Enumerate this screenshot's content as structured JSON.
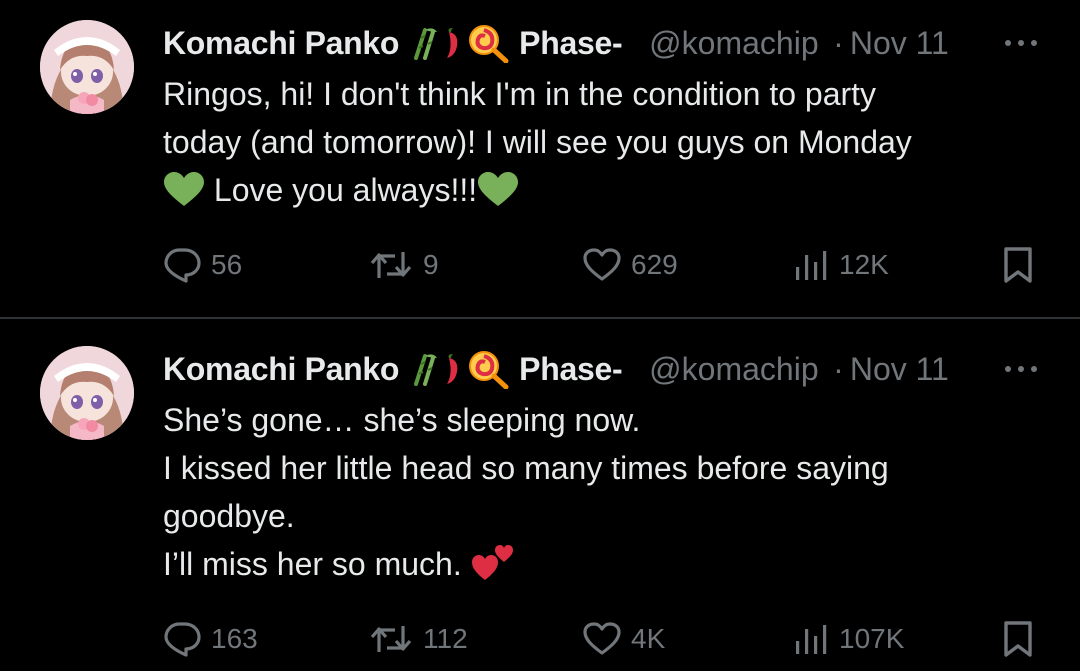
{
  "tweets": [
    {
      "author": "Komachi Panko",
      "display_suffix": "Phase-",
      "handle": "@komachip",
      "separator": "·",
      "date": "Nov 11",
      "emoji_icons": [
        "bamboo-icon",
        "chili-pepper-icon",
        "lollipop-icon"
      ],
      "text_lines": [
        "Ringos, hi! I don't think I'm in the condition to party",
        "today (and tomorrow)! I will see you guys on Monday",
        "Love you always!!!"
      ],
      "reply_count": "56",
      "retweet_count": "9",
      "like_count": "629",
      "view_count": "12K"
    },
    {
      "author": "Komachi Panko",
      "display_suffix": "Phase-",
      "handle": "@komachip",
      "separator": "·",
      "date": "Nov 11",
      "emoji_icons": [
        "bamboo-icon",
        "chili-pepper-icon",
        "lollipop-icon"
      ],
      "text_lines": [
        "She’s gone… she’s sleeping now.",
        "I kissed her little head so many times before saying",
        "goodbye.",
        "I’ll miss her so much."
      ],
      "reply_count": "163",
      "retweet_count": "112",
      "like_count": "4K",
      "view_count": "107K"
    }
  ],
  "colors": {
    "background": "#000000",
    "text": "#e7e9ea",
    "muted": "#71767b",
    "divider": "#2f3336",
    "green_heart": "#78b159",
    "pink_hearts": "#dd2e44"
  }
}
